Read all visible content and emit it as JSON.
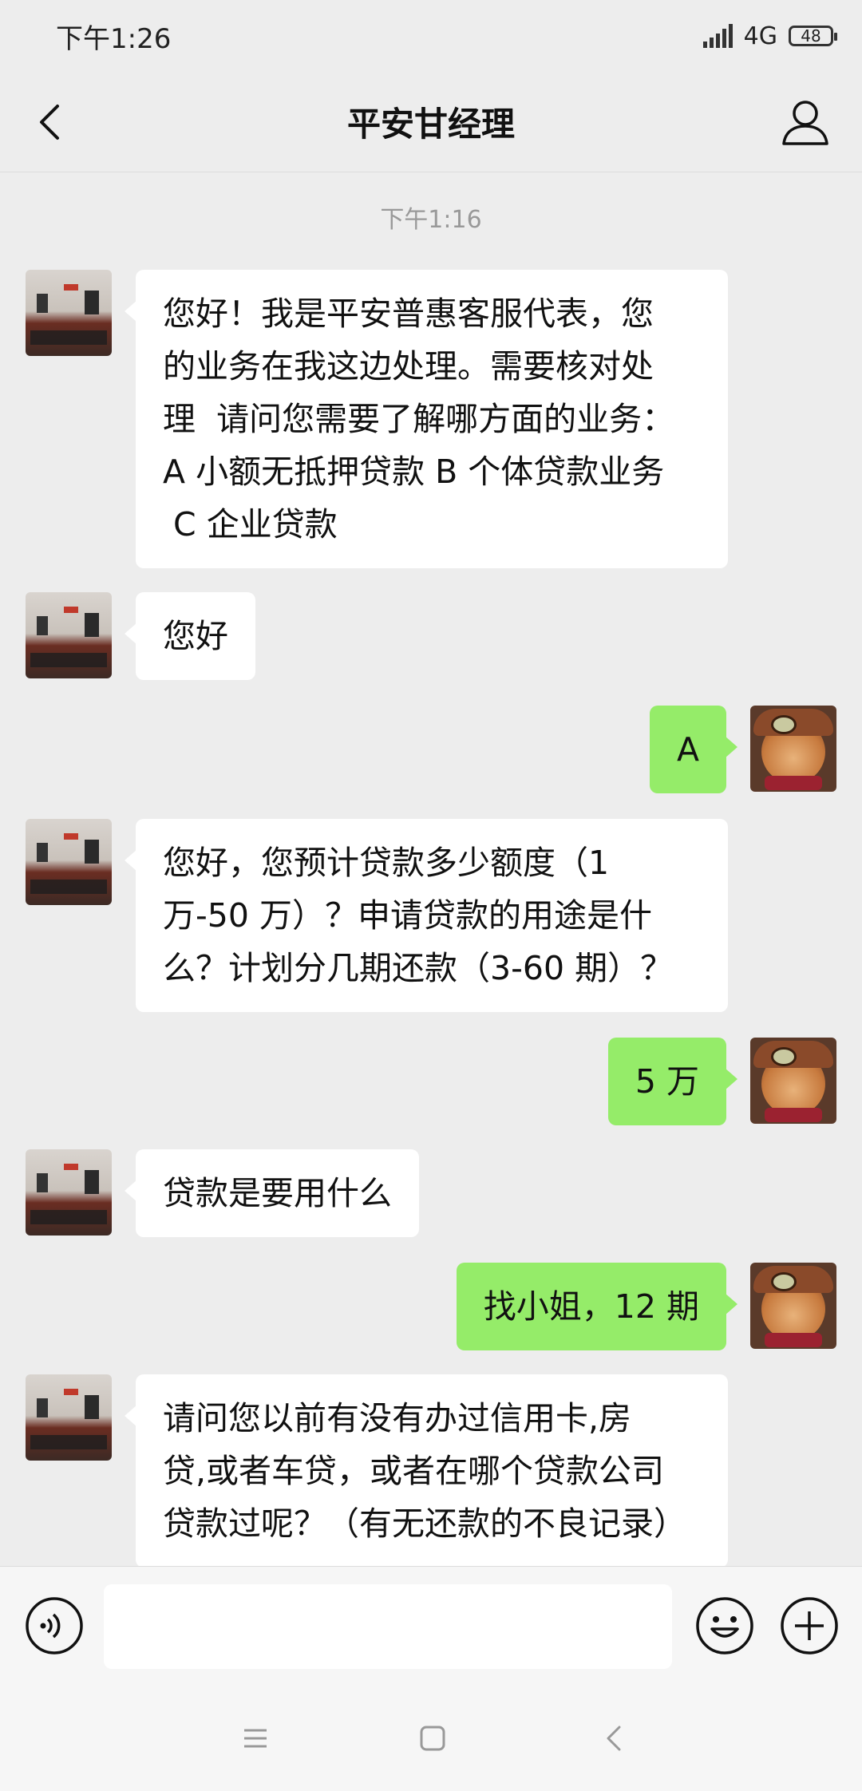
{
  "status": {
    "time": "下午1:26",
    "network": "4G",
    "battery": "48"
  },
  "header": {
    "title": "平安甘经理",
    "icons": [
      "back-arrow-icon",
      "profile-icon"
    ]
  },
  "chat": {
    "timestamp": "下午1:16",
    "messages": [
      {
        "side": "left",
        "text": "您好！我是平安普惠客服代表，您\n的业务在我这边处理。需要核对处\n理  请问您需要了解哪方面的业务：\nA 小额无抵押贷款 B 个体贷款业务\n C 企业贷款"
      },
      {
        "side": "left",
        "text": "您好"
      },
      {
        "side": "right",
        "text": "A"
      },
      {
        "side": "left",
        "text": "您好，您预计贷款多少额度（1\n万-50 万）？申请贷款的用途是什\n么？计划分几期还款（3-60 期）？"
      },
      {
        "side": "right",
        "text": "5 万"
      },
      {
        "side": "left",
        "text": "贷款是要用什么"
      },
      {
        "side": "right",
        "text": "找小姐，12 期"
      },
      {
        "side": "left",
        "text": "请问您以前有没有办过信用卡,房\n贷,或者车贷，或者在哪个贷款公司\n贷款过呢？（有无还款的不良记录）"
      }
    ]
  },
  "input": {
    "value": "",
    "placeholder": "",
    "icons": [
      "voice-icon",
      "emoji-icon",
      "plus-icon"
    ]
  },
  "navigation": {
    "icons": [
      "menu-icon",
      "home-icon",
      "back-icon"
    ]
  },
  "colors": {
    "background": "#ededed",
    "sent_bubble": "#95ec69",
    "received_bubble": "#ffffff"
  }
}
